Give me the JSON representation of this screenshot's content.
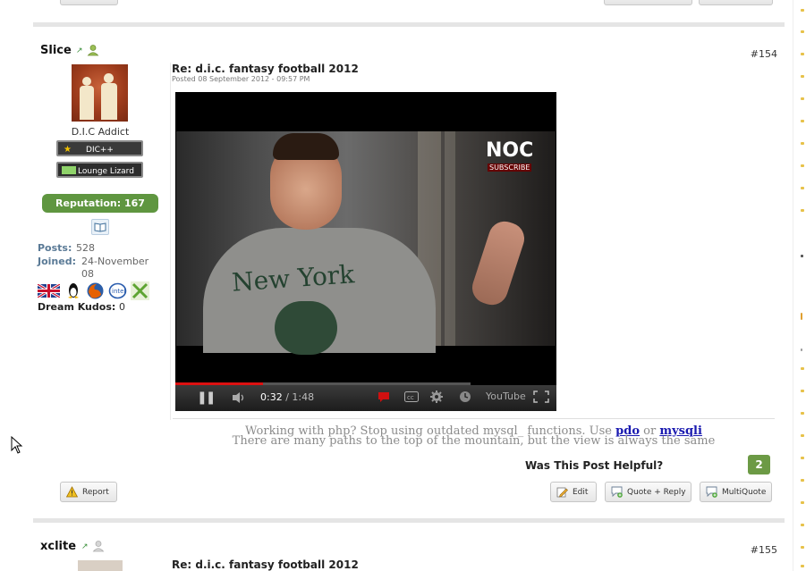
{
  "post": {
    "username": "Slice",
    "post_number": "#154",
    "rank_title": "D.I.C Addict",
    "badges": [
      "DIC++",
      "Lounge Lizard"
    ],
    "reputation_label": "Reputation: 167",
    "stats": {
      "posts_label": "Posts:",
      "posts_value": "528",
      "joined_label": "Joined:",
      "joined_value_line1": "24-November",
      "joined_value_line2": "08"
    },
    "kudos_label": "Dream Kudos:",
    "kudos_value": "0",
    "title": "Re: d.i.c. fantasy football 2012",
    "posted": "Posted 08 September 2012 - 09:57 PM",
    "video": {
      "current_time": "0:32",
      "duration": "/ 1:48",
      "progress": 0.296,
      "overlay_logo": "NOC",
      "overlay_subscribe": "SUBSCRIBE",
      "shirt_text": "New York",
      "youtube_label": "YouTube"
    },
    "signature": {
      "line1_prefix": "Working with php? Stop using outdated mysql_ functions. Use",
      "link1": "pdo",
      "or": "or",
      "link2": "mysqli",
      "line2": "There are many paths to the top of the mountain, but the view is always the same"
    },
    "helpful_label": "Was This Post Helpful?",
    "helpful_count": "2",
    "buttons": {
      "report": "Report",
      "edit": "Edit",
      "quote_reply": "Quote + Reply",
      "multiquote": "MultiQuote"
    }
  },
  "next_post": {
    "username": "xclite",
    "post_number": "#155",
    "title": "Re: d.i.c. fantasy football 2012"
  },
  "colors": {
    "reputation": "#5f9640",
    "helpful": "#6c9a45",
    "link": "#1a1ab0",
    "sidebar_bullet": "#e7c24a"
  }
}
